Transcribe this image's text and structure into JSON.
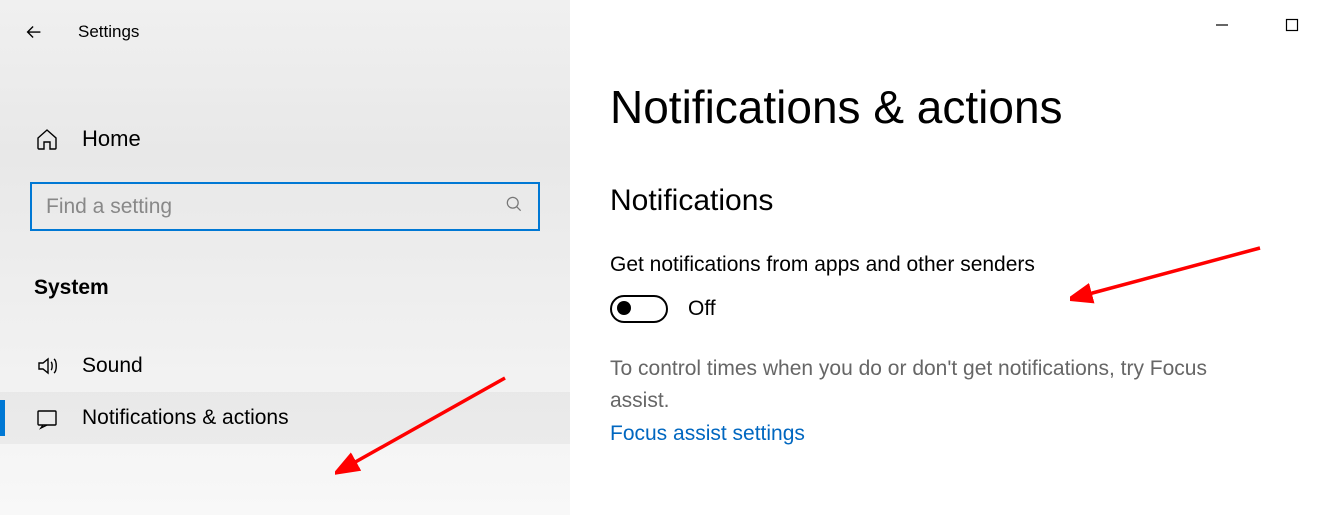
{
  "app": {
    "title": "Settings"
  },
  "sidebar": {
    "home": "Home",
    "search_placeholder": "Find a setting",
    "category": "System",
    "items": [
      {
        "label": "Sound",
        "icon": "sound-icon",
        "selected": false
      },
      {
        "label": "Notifications & actions",
        "icon": "notification-icon",
        "selected": true
      }
    ]
  },
  "main": {
    "title": "Notifications & actions",
    "section": "Notifications",
    "toggle_label": "Get notifications from apps and other senders",
    "toggle_state": "Off",
    "description": "To control times when you do or don't get notifications, try Focus assist.",
    "link": "Focus assist settings"
  }
}
